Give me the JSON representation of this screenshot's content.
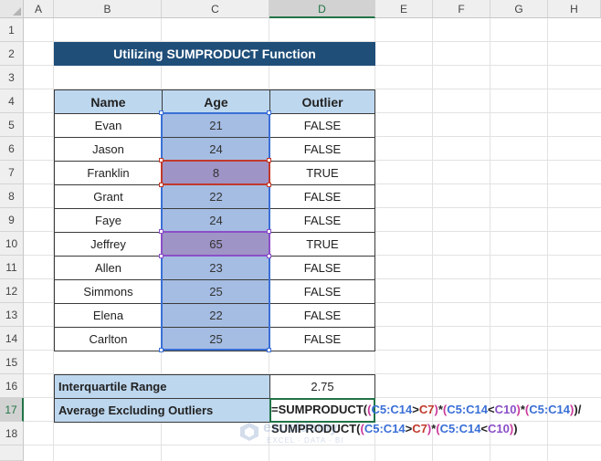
{
  "columns": [
    "A",
    "B",
    "C",
    "D",
    "E",
    "F",
    "G",
    "H"
  ],
  "rows": [
    "1",
    "2",
    "3",
    "4",
    "5",
    "6",
    "7",
    "8",
    "9",
    "10",
    "11",
    "12",
    "13",
    "14",
    "15",
    "16",
    "17",
    "18"
  ],
  "selected_column": "D",
  "selected_row": "17",
  "title": "Utilizing SUMPRODUCT Function",
  "table": {
    "headers": [
      "Name",
      "Age",
      "Outlier"
    ],
    "rows": [
      [
        "Evan",
        "21",
        "FALSE"
      ],
      [
        "Jason",
        "24",
        "FALSE"
      ],
      [
        "Franklin",
        "8",
        "TRUE"
      ],
      [
        "Grant",
        "22",
        "FALSE"
      ],
      [
        "Faye",
        "24",
        "FALSE"
      ],
      [
        "Jeffrey",
        "65",
        "TRUE"
      ],
      [
        "Allen",
        "23",
        "FALSE"
      ],
      [
        "Simmons",
        "25",
        "FALSE"
      ],
      [
        "Elena",
        "22",
        "FALSE"
      ],
      [
        "Carlton",
        "25",
        "FALSE"
      ]
    ]
  },
  "summary": {
    "iqr_label": "Interquartile Range",
    "iqr_value": "2.75",
    "avg_label": "Average Excluding Outliers"
  },
  "formula": {
    "line1": "=SUMPRODUCT((C5:C14>C7)*(C5:C14<C10)*(C5:C14))/",
    "line2": "SUMPRODUCT((C5:C14>C7)*(C5:C14<C10))"
  },
  "watermark": {
    "name": "exceldemy",
    "tagline": "EXCEL · DATA · BI"
  },
  "colors": {
    "title_bg": "#1f4e79",
    "header_bg": "#bdd7ee",
    "selection_bg": "#a5bde3",
    "ref_blue": "#3a6fd6",
    "ref_red": "#c0392b",
    "ref_purple": "#8a4fc7"
  }
}
